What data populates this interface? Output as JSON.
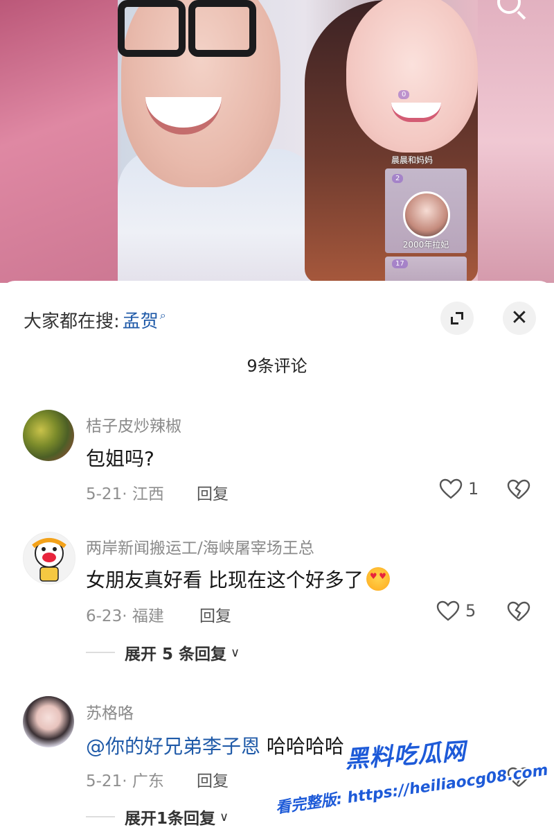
{
  "video": {
    "live_name": "晨晨和妈妈",
    "badge_1": "0",
    "badge_2": "2",
    "badge_3": "17",
    "card_name": "2000年拉妃"
  },
  "sheet": {
    "hot_search_prefix": "大家都在搜:",
    "hot_search_term": "孟贺",
    "comment_count": "9条评论"
  },
  "comments": [
    {
      "username": "桔子皮炒辣椒",
      "text": "包姐吗?",
      "date_location": "5-21· 江西",
      "reply": "回复",
      "likes": "1"
    },
    {
      "username": "两岸新闻搬运工/海峡屠宰场王总",
      "text": "女朋友真好看 比现在这个好多了",
      "date_location": "6-23· 福建",
      "reply": "回复",
      "likes": "5",
      "expand": "展开 5 条回复"
    },
    {
      "username": "苏格咯",
      "mention": "@你的好兄弟李子恩",
      "text": " 哈哈哈哈",
      "date_location": "5-21· 广东",
      "reply": "回复",
      "expand": "展开1条回复"
    }
  ],
  "watermark": {
    "title": "黑料吃瓜网",
    "url": "看完整版: https://heiliaocg08.com"
  },
  "colors": {
    "link": "#1f5aa8",
    "watermark": "#1d5ad8"
  }
}
